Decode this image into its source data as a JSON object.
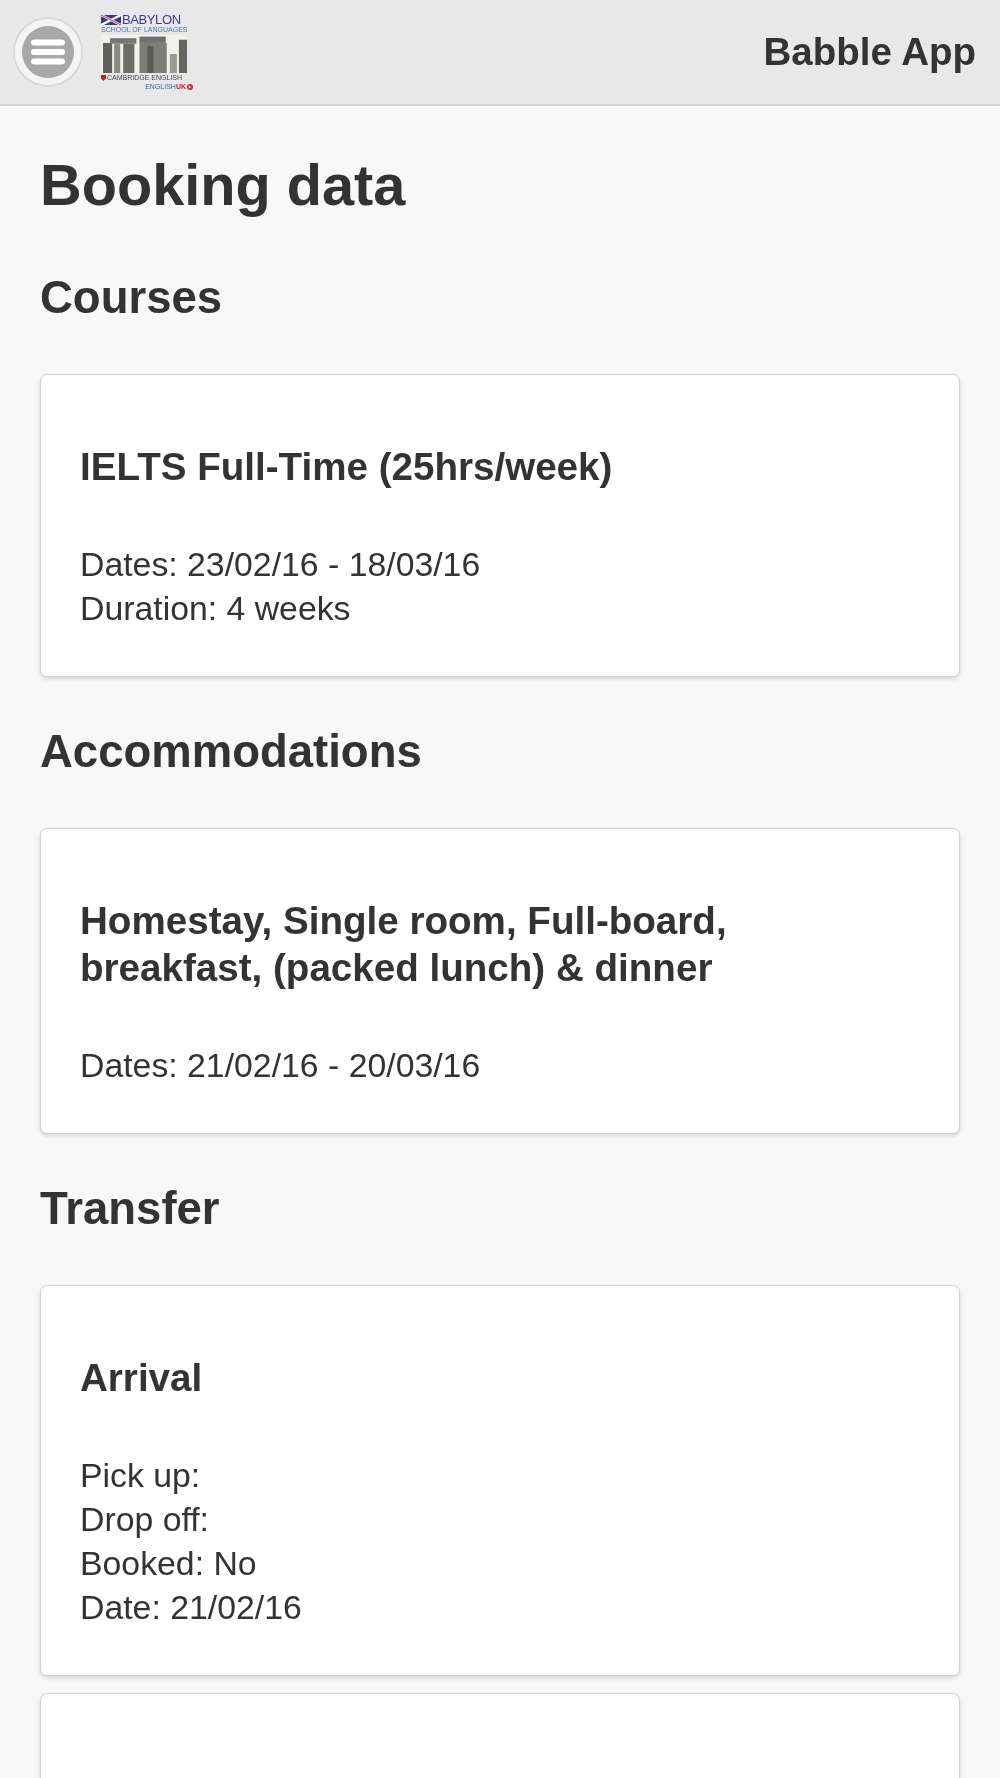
{
  "header": {
    "logo": {
      "name": "BABYLON",
      "subtitle": "SCHOOL OF LANGUAGES",
      "accreditation_left": "CAMBRIDGE ENGLISH",
      "accreditation_right": "ENGLISH**UK**"
    },
    "app_title": "Babble App"
  },
  "page_title": "Booking data",
  "sections": [
    {
      "heading": "Courses",
      "cards": [
        {
          "kind": "details",
          "title": "IELTS Full-Time (25hrs/week)",
          "lines": [
            "Dates: 23/02/16 - 18/03/16",
            "Duration: 4 weeks"
          ]
        }
      ]
    },
    {
      "heading": "Accommodations",
      "cards": [
        {
          "kind": "details",
          "title": "Homestay, Single room, Full-board, breakfast, (packed lunch) & dinner",
          "lines": [
            "Dates: 21/02/16 - 20/03/16"
          ]
        }
      ]
    },
    {
      "heading": "Transfer",
      "cards": [
        {
          "kind": "details",
          "title": "Arrival",
          "lines": [
            "Pick up:",
            "Drop off:",
            "Booked: No",
            "Date: 21/02/16"
          ]
        },
        {
          "kind": "clipped"
        }
      ]
    }
  ]
}
